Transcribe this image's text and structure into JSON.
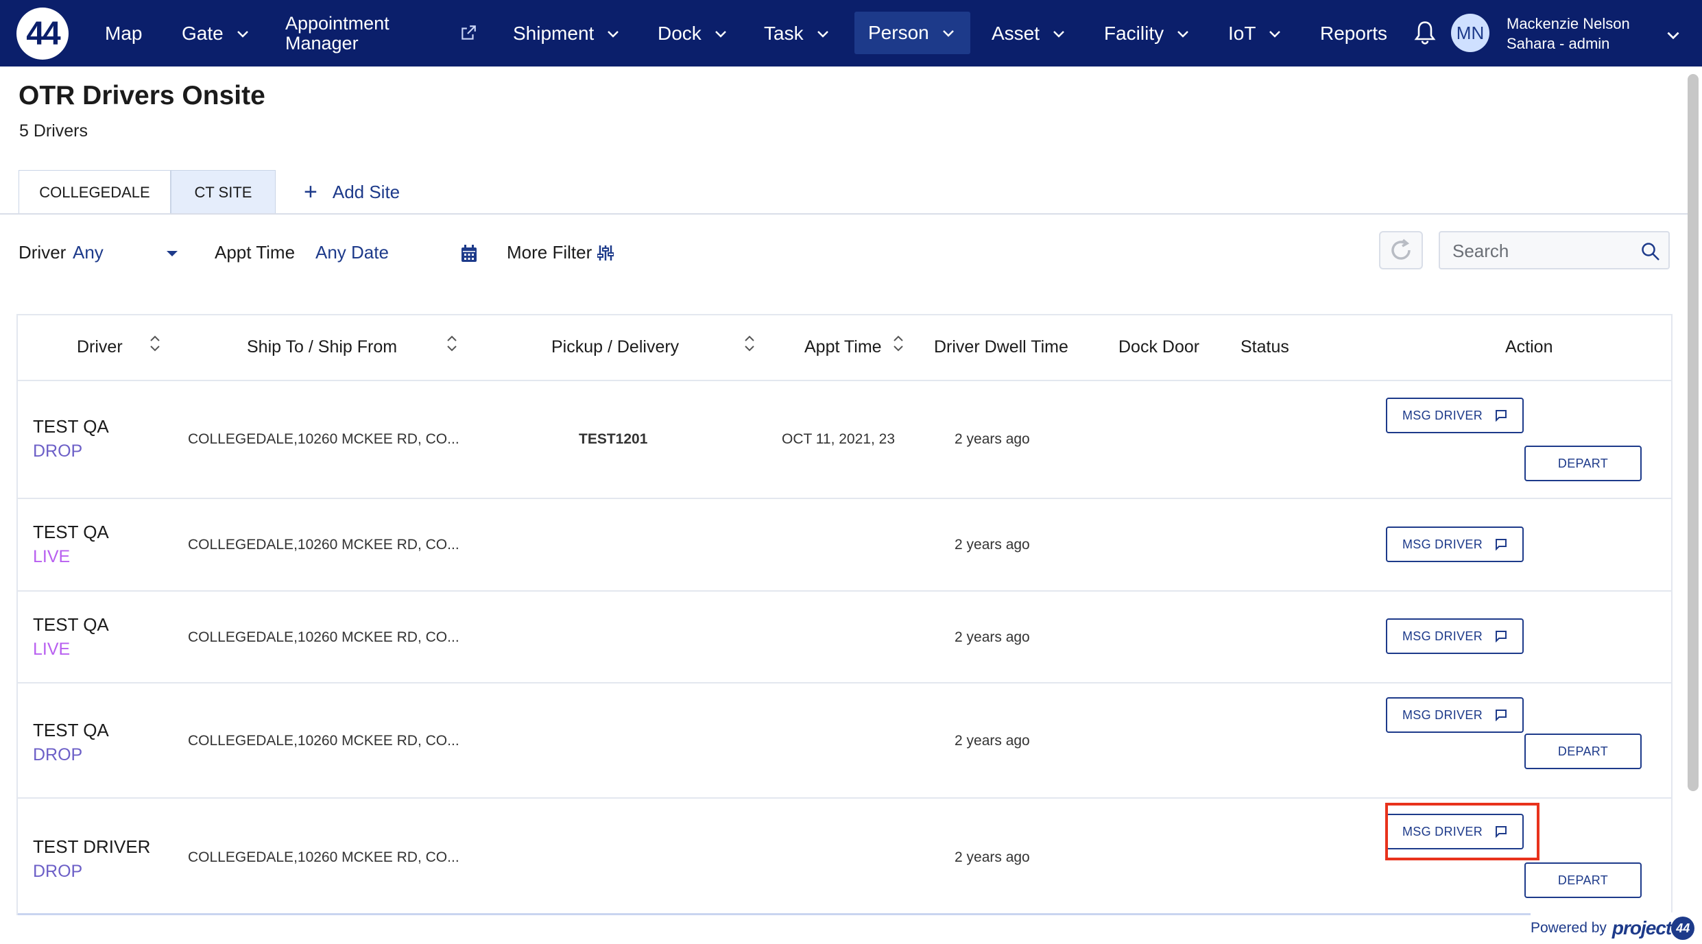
{
  "app": {
    "logo_text": "44",
    "colors": {
      "nav_bg": "#0b1f6b",
      "accent": "#1d3a8a",
      "drop": "#6c5fc7",
      "live": "#b85ff0",
      "highlight": "#e8321c"
    }
  },
  "nav": {
    "items": [
      {
        "label": "Map"
      },
      {
        "label": "Gate"
      },
      {
        "label_line1": "Appointment",
        "label_line2": "Manager"
      },
      {
        "label": "Shipment"
      },
      {
        "label": "Dock"
      },
      {
        "label": "Task"
      },
      {
        "label": "Person"
      },
      {
        "label": "Asset"
      },
      {
        "label": "Facility"
      },
      {
        "label": "IoT"
      },
      {
        "label": "Reports"
      }
    ],
    "avatar_initials": "MN",
    "user_name": "Mackenzie Nelson",
    "user_role": "Sahara - admin"
  },
  "page": {
    "title": "OTR Drivers Onsite",
    "count": "5 Drivers"
  },
  "tabs": [
    {
      "label": "COLLEGEDALE"
    },
    {
      "label": "CT SITE"
    }
  ],
  "add_site_label": "Add Site",
  "filters": {
    "driver_label": "Driver",
    "driver_value": "Any",
    "appt_label": "Appt Time",
    "appt_value": "Any Date",
    "more_filter_label": "More Filter",
    "search_placeholder": "Search"
  },
  "table": {
    "headers": {
      "driver": "Driver",
      "ship": "Ship To / Ship From",
      "pickup": "Pickup / Delivery",
      "appt": "Appt Time",
      "dwell": "Driver Dwell Time",
      "dock": "Dock Door",
      "status": "Status",
      "action": "Action"
    },
    "rows": [
      {
        "name": "TEST QA",
        "type": "DROP",
        "ship": "COLLEGEDALE,10260 MCKEE RD, CO...",
        "pickup": "TEST1201",
        "appt": "OCT 11, 2021, 23:",
        "dwell": "2 years ago",
        "msg": "MSG DRIVER",
        "depart": "DEPART"
      },
      {
        "name": "TEST QA",
        "type": "LIVE",
        "ship": "COLLEGEDALE,10260 MCKEE RD, CO...",
        "dwell": "2 years ago",
        "msg": "MSG DRIVER"
      },
      {
        "name": "TEST QA",
        "type": "LIVE",
        "ship": "COLLEGEDALE,10260 MCKEE RD, CO...",
        "dwell": "2 years ago",
        "msg": "MSG DRIVER"
      },
      {
        "name": "TEST QA",
        "type": "DROP",
        "ship": "COLLEGEDALE,10260 MCKEE RD, CO...",
        "dwell": "2 years ago",
        "msg": "MSG DRIVER",
        "depart": "DEPART"
      },
      {
        "name": "TEST DRIVER",
        "type": "DROP",
        "ship": "COLLEGEDALE,10260 MCKEE RD, CO...",
        "dwell": "2 years ago",
        "msg": "MSG DRIVER",
        "depart": "DEPART"
      }
    ]
  },
  "footer": {
    "powered_by": "Powered by",
    "brand": "project",
    "brand_badge": "44"
  }
}
